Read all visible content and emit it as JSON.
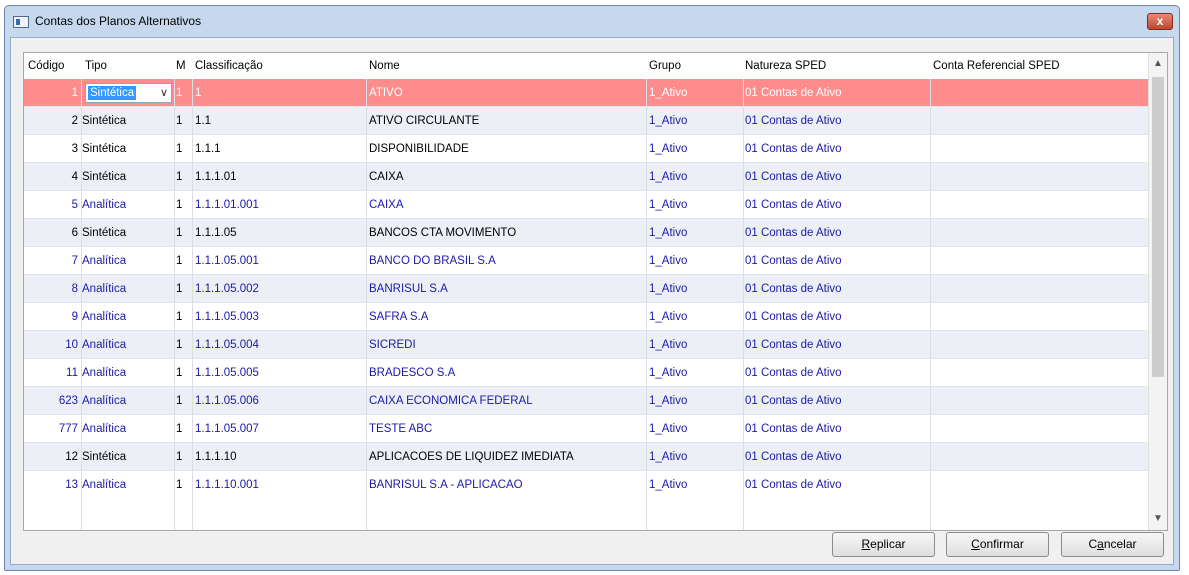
{
  "window": {
    "title": "Contas dos Planos Alternativos",
    "close_glyph": "x"
  },
  "columns": [
    "Código",
    "Tipo",
    "M",
    "Classificação",
    "Nome",
    "Grupo",
    "Natureza SPED",
    "Conta Referencial SPED"
  ],
  "rows": [
    {
      "codigo": "1",
      "tipo": "Sintética",
      "m": "1",
      "classificacao": "1",
      "nome": "ATIVO",
      "grupo": "1_Ativo",
      "natureza": "01 Contas de Ativo",
      "referencial": "",
      "selected": true,
      "blue": false
    },
    {
      "codigo": "2",
      "tipo": "Sintética",
      "m": "1",
      "classificacao": "1.1",
      "nome": "ATIVO CIRCULANTE",
      "grupo": "1_Ativo",
      "natureza": "01 Contas de Ativo",
      "referencial": "",
      "selected": false,
      "blue": false
    },
    {
      "codigo": "3",
      "tipo": "Sintética",
      "m": "1",
      "classificacao": "1.1.1",
      "nome": "DISPONIBILIDADE",
      "grupo": "1_Ativo",
      "natureza": "01 Contas de Ativo",
      "referencial": "",
      "selected": false,
      "blue": false
    },
    {
      "codigo": "4",
      "tipo": "Sintética",
      "m": "1",
      "classificacao": "1.1.1.01",
      "nome": "CAIXA",
      "grupo": "1_Ativo",
      "natureza": "01 Contas de Ativo",
      "referencial": "",
      "selected": false,
      "blue": false
    },
    {
      "codigo": "5",
      "tipo": "Analítica",
      "m": "1",
      "classificacao": "1.1.1.01.001",
      "nome": "CAIXA",
      "grupo": "1_Ativo",
      "natureza": "01 Contas de Ativo",
      "referencial": "",
      "selected": false,
      "blue": true
    },
    {
      "codigo": "6",
      "tipo": "Sintética",
      "m": "1",
      "classificacao": "1.1.1.05",
      "nome": "BANCOS CTA MOVIMENTO",
      "grupo": "1_Ativo",
      "natureza": "01 Contas de Ativo",
      "referencial": "",
      "selected": false,
      "blue": false
    },
    {
      "codigo": "7",
      "tipo": "Analítica",
      "m": "1",
      "classificacao": "1.1.1.05.001",
      "nome": "BANCO DO BRASIL S.A",
      "grupo": "1_Ativo",
      "natureza": "01 Contas de Ativo",
      "referencial": "",
      "selected": false,
      "blue": true
    },
    {
      "codigo": "8",
      "tipo": "Analítica",
      "m": "1",
      "classificacao": "1.1.1.05.002",
      "nome": "BANRISUL S.A",
      "grupo": "1_Ativo",
      "natureza": "01 Contas de Ativo",
      "referencial": "",
      "selected": false,
      "blue": true
    },
    {
      "codigo": "9",
      "tipo": "Analítica",
      "m": "1",
      "classificacao": "1.1.1.05.003",
      "nome": "SAFRA S.A",
      "grupo": "1_Ativo",
      "natureza": "01 Contas de Ativo",
      "referencial": "",
      "selected": false,
      "blue": true
    },
    {
      "codigo": "10",
      "tipo": "Analítica",
      "m": "1",
      "classificacao": "1.1.1.05.004",
      "nome": "SICREDI",
      "grupo": "1_Ativo",
      "natureza": "01 Contas de Ativo",
      "referencial": "",
      "selected": false,
      "blue": true
    },
    {
      "codigo": "11",
      "tipo": "Analítica",
      "m": "1",
      "classificacao": "1.1.1.05.005",
      "nome": "BRADESCO S.A",
      "grupo": "1_Ativo",
      "natureza": "01 Contas de Ativo",
      "referencial": "",
      "selected": false,
      "blue": true
    },
    {
      "codigo": "623",
      "tipo": "Analítica",
      "m": "1",
      "classificacao": "1.1.1.05.006",
      "nome": "CAIXA ECONOMICA FEDERAL",
      "grupo": "1_Ativo",
      "natureza": "01 Contas de Ativo",
      "referencial": "",
      "selected": false,
      "blue": true
    },
    {
      "codigo": "777",
      "tipo": "Analítica",
      "m": "1",
      "classificacao": "1.1.1.05.007",
      "nome": "TESTE ABC",
      "grupo": "1_Ativo",
      "natureza": "01 Contas de Ativo",
      "referencial": "",
      "selected": false,
      "blue": true
    },
    {
      "codigo": "12",
      "tipo": "Sintética",
      "m": "1",
      "classificacao": "1.1.1.10",
      "nome": "APLICACOES DE LIQUIDEZ IMEDIATA",
      "grupo": "1_Ativo",
      "natureza": "01 Contas de Ativo",
      "referencial": "",
      "selected": false,
      "blue": false
    },
    {
      "codigo": "13",
      "tipo": "Analítica",
      "m": "1",
      "classificacao": "1.1.1.10.001",
      "nome": "BANRISUL S.A - APLICACAO",
      "grupo": "1_Ativo",
      "natureza": "01 Contas de Ativo",
      "referencial": "",
      "selected": false,
      "blue": true
    }
  ],
  "buttons": [
    {
      "name": "replicar-button",
      "label": "Replicar",
      "accel": "R"
    },
    {
      "name": "confirmar-button",
      "label": "Confirmar",
      "accel": "C"
    },
    {
      "name": "cancelar-button",
      "label": "Cancelar",
      "accel": "a"
    }
  ],
  "colors": {
    "selected_row": "#ff8c8c",
    "alt_row": "#eceff6",
    "link_blue": "#1a1aa8"
  }
}
